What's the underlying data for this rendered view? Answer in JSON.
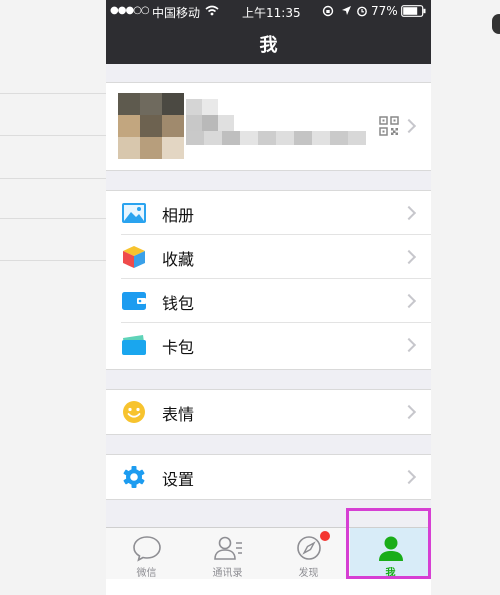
{
  "status_bar": {
    "signal": "●●●○○",
    "carrier": "中国移动",
    "time": "上午11:35",
    "battery": "77%"
  },
  "nav": {
    "title": "我"
  },
  "profile": {
    "qr_icon": "qr-code-icon",
    "chevron": "chevron-right-icon"
  },
  "menu": {
    "group1": [
      {
        "label": "相册",
        "icon": "photo-album-icon"
      },
      {
        "label": "收藏",
        "icon": "favorites-cube-icon"
      },
      {
        "label": "钱包",
        "icon": "wallet-icon"
      },
      {
        "label": "卡包",
        "icon": "card-pack-icon"
      }
    ],
    "group2": [
      {
        "label": "表情",
        "icon": "smiley-icon"
      }
    ],
    "group3": [
      {
        "label": "设置",
        "icon": "gear-icon"
      }
    ]
  },
  "tabs": [
    {
      "label": "微信",
      "icon": "chat-bubble-icon",
      "active": false
    },
    {
      "label": "通讯录",
      "icon": "contacts-icon",
      "active": false
    },
    {
      "label": "发现",
      "icon": "compass-icon",
      "active": false,
      "badge": true
    },
    {
      "label": "我",
      "icon": "person-icon",
      "active": true
    }
  ],
  "colors": {
    "nav_bg": "#2d2d31",
    "accent_green": "#1aad19",
    "badge_red": "#f43530",
    "highlight_magenta": "#d63fd3"
  }
}
